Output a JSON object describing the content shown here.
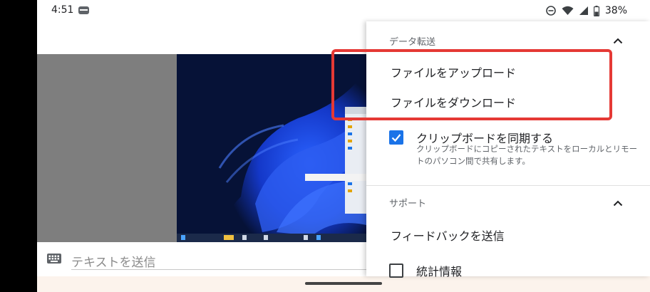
{
  "status_bar": {
    "time": "4:51",
    "battery": "38%",
    "icons": [
      "message-icon",
      "do-not-disturb-icon",
      "wifi-icon",
      "signal-icon",
      "battery-icon"
    ]
  },
  "input": {
    "placeholder": "テキストを送信",
    "icon": "keyboard-icon"
  },
  "menu": {
    "data_transfer": {
      "header": "データ転送",
      "upload": "ファイルをアップロード",
      "download": "ファイルをダウンロード",
      "clipboard_sync": {
        "label": "クリップボードを同期する",
        "description": "クリップボードにコピーされたテキストをローカルとリモートのパソコン間で共有します。",
        "checked": true
      }
    },
    "support": {
      "header": "サポート",
      "feedback": "フィードバックを送信",
      "stats": {
        "label": "統計情報",
        "checked": false
      }
    }
  },
  "colors": {
    "highlight": "#e53935",
    "checkbox_on": "#1a73e8",
    "remote_bg": "#061237"
  }
}
